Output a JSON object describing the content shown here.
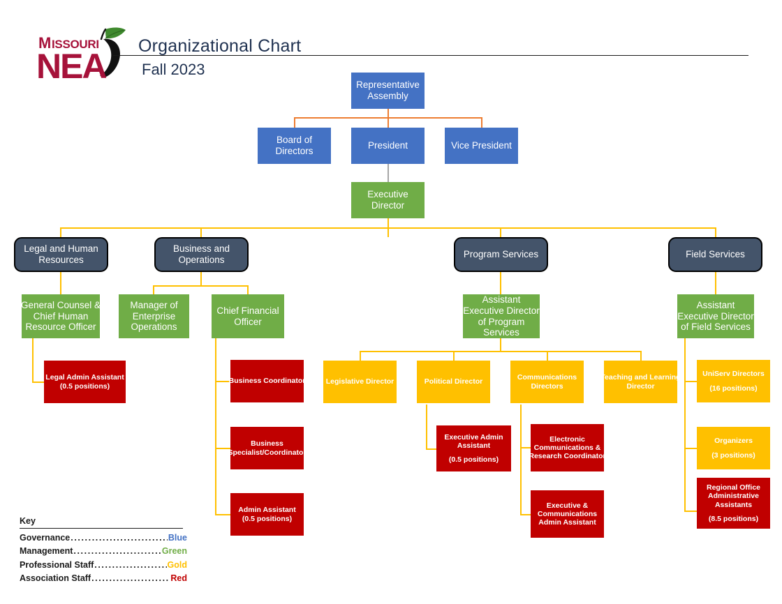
{
  "header": {
    "logo_top": "Missouri",
    "logo_bottom": "NEA",
    "logo_icon": "apple-with-leaf-icon",
    "title": "Organizational Chart",
    "subtitle": "Fall 2023"
  },
  "colors": {
    "governance_blue": "#4472C4",
    "management_green": "#70AD47",
    "professional_gold": "#FFC000",
    "association_red": "#C00000",
    "department_slate": "#44546A",
    "connector_gold": "#FFC000",
    "connector_orange": "#ED7D31",
    "connector_grey": "#A6A6A6",
    "logo_red": "#A6123A"
  },
  "chart_data": {
    "type": "diagram",
    "title": "Organizational Chart",
    "subtitle": "Fall 2023",
    "nodes": [
      {
        "id": "rep_assembly",
        "label_lines": [
          "Representative",
          "Assembly"
        ],
        "category": "Governance",
        "parent": null
      },
      {
        "id": "board",
        "label_lines": [
          "Board of",
          "Directors"
        ],
        "category": "Governance",
        "parent": "rep_assembly"
      },
      {
        "id": "president",
        "label_lines": [
          "President"
        ],
        "category": "Governance",
        "parent": "rep_assembly"
      },
      {
        "id": "vice_pres",
        "label_lines": [
          "Vice President"
        ],
        "category": "Governance",
        "parent": "rep_assembly"
      },
      {
        "id": "exec_director",
        "label_lines": [
          "Executive",
          "Director"
        ],
        "category": "Management",
        "parent": "president"
      },
      {
        "id": "dept_legal",
        "label_lines": [
          "Legal and Human",
          "Resources"
        ],
        "category": "Department",
        "parent": "exec_director"
      },
      {
        "id": "dept_business",
        "label_lines": [
          "Business and",
          "Operations"
        ],
        "category": "Department",
        "parent": "exec_director"
      },
      {
        "id": "dept_program",
        "label_lines": [
          "Program Services"
        ],
        "category": "Department",
        "parent": "exec_director"
      },
      {
        "id": "dept_field",
        "label_lines": [
          "Field Services"
        ],
        "category": "Department",
        "parent": "exec_director"
      },
      {
        "id": "general_counsel",
        "label_lines": [
          "General Counsel &",
          "Chief Human",
          "Resource Officer"
        ],
        "category": "Management",
        "parent": "dept_legal"
      },
      {
        "id": "legal_admin",
        "label_lines": [
          "Legal Admin Assistant",
          "(0.5 positions)"
        ],
        "category": "Association Staff",
        "parent": "general_counsel"
      },
      {
        "id": "mgr_enterprise",
        "label_lines": [
          "Manager of",
          "Enterprise",
          "Operations"
        ],
        "category": "Management",
        "parent": "dept_business"
      },
      {
        "id": "cfo",
        "label_lines": [
          "Chief Financial",
          "Officer"
        ],
        "category": "Management",
        "parent": "dept_business"
      },
      {
        "id": "business_coord",
        "label_lines": [
          "Business Coordinator"
        ],
        "category": "Association Staff",
        "parent": "cfo"
      },
      {
        "id": "business_spec",
        "label_lines": [
          "Business",
          "Specialist/Coordinator"
        ],
        "category": "Association Staff",
        "parent": "cfo"
      },
      {
        "id": "admin_assistant",
        "label_lines": [
          "Admin Assistant",
          "(0.5 positions)"
        ],
        "category": "Association Staff",
        "parent": "cfo"
      },
      {
        "id": "aed_program",
        "label_lines": [
          "Assistant",
          "Executive Director",
          "of Program",
          "Services"
        ],
        "category": "Management",
        "parent": "dept_program"
      },
      {
        "id": "legislative_dir",
        "label_lines": [
          "Legislative Director"
        ],
        "category": "Professional Staff",
        "parent": "aed_program"
      },
      {
        "id": "political_dir",
        "label_lines": [
          "Political Director"
        ],
        "category": "Professional Staff",
        "parent": "aed_program"
      },
      {
        "id": "comms_dirs",
        "label_lines": [
          "Communications",
          "Directors"
        ],
        "category": "Professional Staff",
        "parent": "aed_program"
      },
      {
        "id": "teaching_dir",
        "label_lines": [
          "Teaching and Learning",
          "Director"
        ],
        "category": "Professional Staff",
        "parent": "aed_program"
      },
      {
        "id": "exec_admin",
        "label_lines": [
          "Executive Admin",
          "Assistant",
          "(0.5 positions)"
        ],
        "category": "Association Staff",
        "parent": "political_dir"
      },
      {
        "id": "electronic_comms",
        "label_lines": [
          "Electronic",
          "Communications &",
          "Research Coordinator"
        ],
        "category": "Association Staff",
        "parent": "comms_dirs"
      },
      {
        "id": "exec_comms_admin",
        "label_lines": [
          "Executive &",
          "Communications",
          "Admin Assistant"
        ],
        "category": "Association Staff",
        "parent": "comms_dirs"
      },
      {
        "id": "aed_field",
        "label_lines": [
          "Assistant",
          "Executive Director",
          "of Field Services"
        ],
        "category": "Management",
        "parent": "dept_field"
      },
      {
        "id": "uniserv",
        "label_lines": [
          "UniServ Directors",
          "(16 positions)"
        ],
        "category": "Professional Staff",
        "parent": "aed_field"
      },
      {
        "id": "organizers",
        "label_lines": [
          "Organizers",
          "(3 positions)"
        ],
        "category": "Professional Staff",
        "parent": "aed_field"
      },
      {
        "id": "regional_admin",
        "label_lines": [
          "Regional Office",
          "Administrative",
          "Assistants",
          "(8.5 positions)"
        ],
        "category": "Association Staff",
        "parent": "aed_field"
      }
    ]
  },
  "nodes": {
    "rep_assembly": {
      "l1": "Representative",
      "l2": "Assembly"
    },
    "board": {
      "l1": "Board of",
      "l2": "Directors"
    },
    "president": {
      "l1": "President"
    },
    "vice_pres": {
      "l1": "Vice President"
    },
    "exec_director": {
      "l1": "Executive",
      "l2": "Director"
    },
    "dept_legal": {
      "l1": "Legal and Human",
      "l2": "Resources"
    },
    "dept_business": {
      "l1": "Business and",
      "l2": "Operations"
    },
    "dept_program": {
      "l1": "Program Services"
    },
    "dept_field": {
      "l1": "Field Services"
    },
    "general_counsel": {
      "l1": "General Counsel &",
      "l2": "Chief Human",
      "l3": "Resource Officer"
    },
    "legal_admin": {
      "l1": "Legal Admin Assistant",
      "l2": "(0.5 positions)"
    },
    "mgr_enterprise": {
      "l1": "Manager of",
      "l2": "Enterprise",
      "l3": "Operations"
    },
    "cfo": {
      "l1": "Chief Financial",
      "l2": "Officer"
    },
    "business_coord": {
      "l1": "Business Coordinator"
    },
    "business_spec": {
      "l1": "Business",
      "l2": "Specialist/Coordinator"
    },
    "admin_assistant": {
      "l1": "Admin Assistant",
      "l2": "(0.5 positions)"
    },
    "aed_program": {
      "l1": "Assistant",
      "l2": "Executive Director",
      "l3": "of Program",
      "l4": "Services"
    },
    "legislative_dir": {
      "l1": "Legislative Director"
    },
    "political_dir": {
      "l1": "Political Director"
    },
    "comms_dirs": {
      "l1": "Communications",
      "l2": "Directors"
    },
    "teaching_dir": {
      "l1": "Teaching and Learning",
      "l2": "Director"
    },
    "exec_admin": {
      "l1": "Executive Admin",
      "l2": "Assistant",
      "l3": "(0.5 positions)"
    },
    "electronic_comms": {
      "l1": "Electronic",
      "l2": "Communications &",
      "l3": "Research Coordinator"
    },
    "exec_comms_admin": {
      "l1": "Executive &",
      "l2": "Communications",
      "l3": "Admin Assistant"
    },
    "aed_field": {
      "l1": "Assistant",
      "l2": "Executive Director",
      "l3": "of Field Services"
    },
    "uniserv": {
      "l1": "UniServ Directors",
      "l2": "(16 positions)"
    },
    "organizers": {
      "l1": "Organizers",
      "l2": "(3 positions)"
    },
    "regional_admin": {
      "l1": "Regional Office",
      "l2": "Administrative",
      "l3": "Assistants",
      "l4": "(8.5 positions)"
    }
  },
  "key": {
    "title": "Key",
    "dots": "........................................................................",
    "rows": [
      {
        "label": "Governance",
        "value": "Blue",
        "color": "#4472C4"
      },
      {
        "label": "Management",
        "value": "Green",
        "color": "#70AD47"
      },
      {
        "label": "Professional Staff",
        "value": "Gold",
        "color": "#FFC000"
      },
      {
        "label": "Association Staff",
        "value": "Red",
        "color": "#C00000"
      }
    ]
  }
}
